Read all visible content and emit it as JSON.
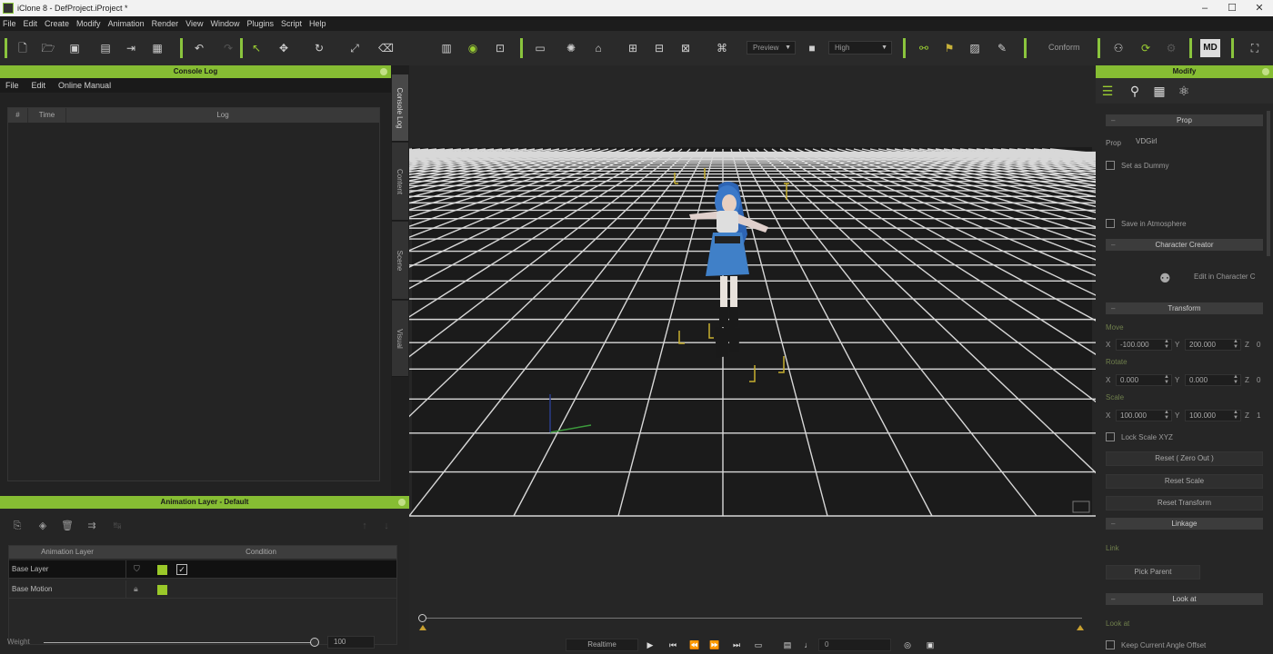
{
  "window": {
    "title": "iClone 8 - DefProject.iProject *",
    "controls": [
      "–",
      "☐",
      "✕"
    ]
  },
  "menu": [
    "File",
    "Edit",
    "Create",
    "Modify",
    "Animation",
    "Render",
    "View",
    "Window",
    "Plugins",
    "Script",
    "Help"
  ],
  "toolbar": {
    "preview_select": "Preview",
    "quality_select": "High",
    "conform_label": "Conform",
    "logo_label": "MD"
  },
  "console": {
    "title": "Console Log",
    "menu": [
      "File",
      "Edit",
      "Online Manual"
    ],
    "columns": [
      "#",
      "Time",
      "Log"
    ]
  },
  "side_tabs": [
    "Console Log",
    "Content",
    "Scene",
    "Visual"
  ],
  "anim_layer": {
    "title": "Animation Layer - Default",
    "columns": [
      "Animation Layer",
      "Condition"
    ],
    "rows": [
      {
        "name": "Base Layer",
        "selected": true,
        "checked": true
      },
      {
        "name": "Base Motion",
        "selected": false,
        "checked": false
      }
    ],
    "weight_label": "Weight",
    "weight_value": "100",
    "weight_fraction": 1.0
  },
  "timeline": {
    "mode": "Realtime",
    "frame": "0"
  },
  "modify": {
    "title": "Modify",
    "prop_section": "Prop",
    "prop_label": "Prop",
    "prop_name": "VDGirl",
    "set_as_dummy": "Set as Dummy",
    "save_in_atmosphere": "Save in Atmosphere",
    "character_creator_section": "Character Creator",
    "edit_in_cc": "Edit in Character C",
    "transform_section": "Transform",
    "move_label": "Move",
    "rotate_label": "Rotate",
    "scale_label": "Scale",
    "move": {
      "x": "-100.000",
      "y": "200.000",
      "z": "0"
    },
    "rotate": {
      "x": "0.000",
      "y": "0.000",
      "z": "0"
    },
    "scale": {
      "x": "100.000",
      "y": "100.000",
      "z": "1"
    },
    "lock_scale_xyz": "Lock Scale XYZ",
    "reset_zero_out": "Reset ( Zero Out )",
    "reset_scale": "Reset Scale",
    "reset_transform": "Reset Transform",
    "linkage_section": "Linkage",
    "link_label": "Link",
    "pick_parent": "Pick Parent",
    "look_at_section": "Look at",
    "look_at_label": "Look at",
    "keep_offset": "Keep Current Angle Offset"
  }
}
